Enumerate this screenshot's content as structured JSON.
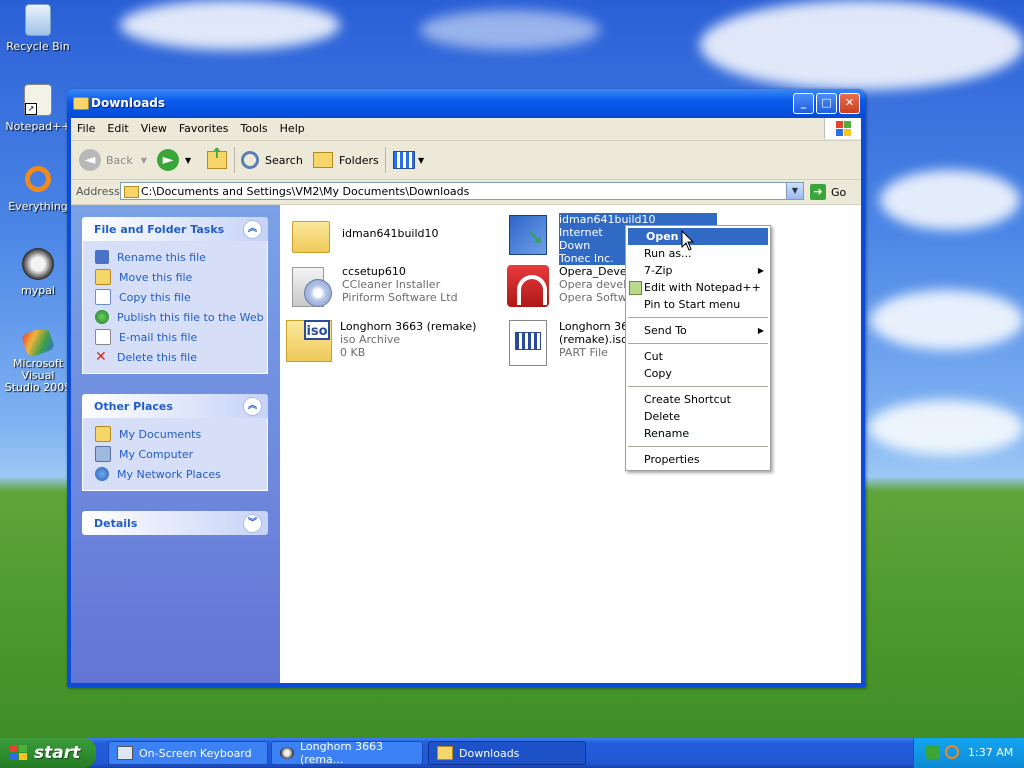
{
  "desktop": {
    "icons": [
      {
        "label": "Recycle Bin"
      },
      {
        "label": "Notepad++"
      },
      {
        "label": "Everything"
      },
      {
        "label": "mypal"
      },
      {
        "label": "Microsoft Visual Studio 2005"
      }
    ]
  },
  "window": {
    "title": "Downloads",
    "menu": [
      "File",
      "Edit",
      "View",
      "Favorites",
      "Tools",
      "Help"
    ],
    "toolbar": {
      "back": "Back",
      "search": "Search",
      "folders": "Folders"
    },
    "address": {
      "label": "Address",
      "value": "C:\\Documents and Settings\\VM2\\My Documents\\Downloads",
      "go": "Go"
    }
  },
  "sidebar": {
    "file_tasks": {
      "title": "File and Folder Tasks",
      "items": [
        "Rename this file",
        "Move this file",
        "Copy this file",
        "Publish this file to the Web",
        "E-mail this file",
        "Delete this file"
      ]
    },
    "other_places": {
      "title": "Other Places",
      "items": [
        "My Documents",
        "My Computer",
        "My Network Places"
      ]
    },
    "details": {
      "title": "Details"
    }
  },
  "files": [
    {
      "name": "idman641build10",
      "line2": "",
      "line3": ""
    },
    {
      "name": "idman641build10",
      "line2": "Internet Down",
      "line3": "Tonec Inc."
    },
    {
      "name": "ccsetup610",
      "line2": "CCleaner Installer",
      "line3": "Piriform Software Ltd"
    },
    {
      "name": "Opera_Develo",
      "line2": "Opera develop",
      "line3": "Opera Softwa"
    },
    {
      "name": "Longhorn 3663 (remake)",
      "line2": "iso Archive",
      "line3": "0 KB"
    },
    {
      "name": "Longhorn 3663",
      "line2": "(remake).iso.p",
      "line3": "PART File"
    }
  ],
  "context_menu": {
    "groups": [
      [
        {
          "label": "Open",
          "highlighted": true
        },
        {
          "label": "Run as..."
        },
        {
          "label": "7-Zip",
          "submenu": true
        },
        {
          "label": "Edit with Notepad++"
        },
        {
          "label": "Pin to Start menu"
        }
      ],
      [
        {
          "label": "Send To",
          "submenu": true
        }
      ],
      [
        {
          "label": "Cut"
        },
        {
          "label": "Copy"
        }
      ],
      [
        {
          "label": "Create Shortcut"
        },
        {
          "label": "Delete"
        },
        {
          "label": "Rename"
        }
      ],
      [
        {
          "label": "Properties"
        }
      ]
    ]
  },
  "taskbar": {
    "start": "start",
    "tasks": [
      {
        "label": "On-Screen Keyboard"
      },
      {
        "label": "Longhorn 3663 (rema..."
      },
      {
        "label": "Downloads",
        "active": true
      }
    ],
    "clock": "1:37 AM"
  },
  "colors": {
    "selection": "#316ac5",
    "title_bar": "#0a5bec",
    "task_link": "#215dc6"
  }
}
